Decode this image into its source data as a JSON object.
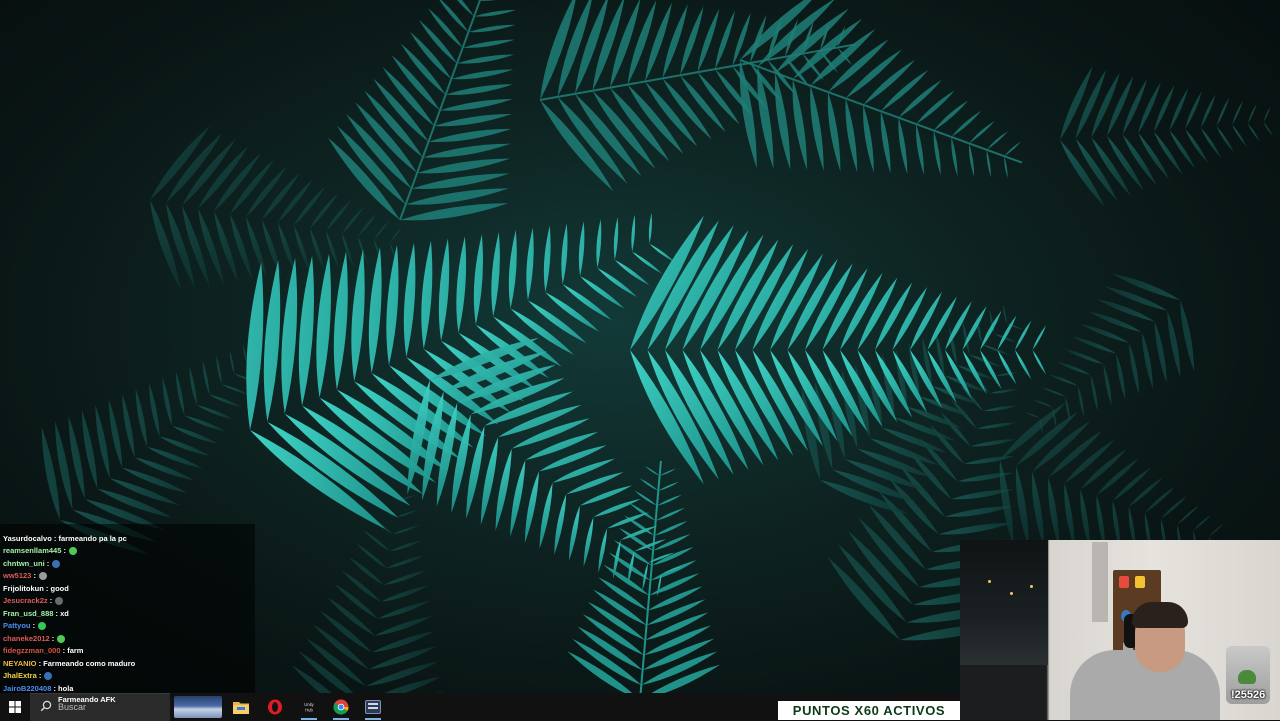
{
  "chat": {
    "messages": [
      {
        "user": "Yasurdocalvo",
        "user_color": "#ffffff",
        "text": "farmeando pa la pc",
        "emote": null
      },
      {
        "user": "reamsenllam445",
        "user_color": "#a5f0a8",
        "text": "",
        "emote": "#4ecb54"
      },
      {
        "user": "chntwn_uni",
        "user_color": "#a5f0a8",
        "text": "",
        "emote": "#3a6fb3"
      },
      {
        "user": "ww5123",
        "user_color": "#e05a5a",
        "text": "",
        "emote": "#9a9a9a"
      },
      {
        "user": "Frijolitokun",
        "user_color": "#ffffff",
        "text": "good",
        "emote": null
      },
      {
        "user": "Jesucrack2z",
        "user_color": "#e05a5a",
        "text": "",
        "emote": "#6b6b6b"
      },
      {
        "user": "Fran_usd_888",
        "user_color": "#a5f0a8",
        "text": "xd",
        "emote": null
      },
      {
        "user": "Pattyou",
        "user_color": "#4b8cf0",
        "text": "",
        "emote": "#34c759"
      },
      {
        "user": "chaneke2012",
        "user_color": "#e05a5a",
        "text": "",
        "emote": "#4ecb54"
      },
      {
        "user": "fidegzzman_000",
        "user_color": "#d9503b",
        "text": "farm",
        "emote": null
      },
      {
        "user": "NEYANIO",
        "user_color": "#f0b64b",
        "text": "Farmeando como maduro",
        "emote": null
      },
      {
        "user": "JhalExtra",
        "user_color": "#f0d24b",
        "text": "",
        "emote": "#3a6fb3"
      },
      {
        "user": "JairoB220408",
        "user_color": "#4b8cf0",
        "text": "hola",
        "emote": null
      }
    ],
    "last_message_text": "Farmeando AFK"
  },
  "taskbar": {
    "search_placeholder": "Buscar",
    "apps": [
      "files-icon",
      "opera-icon",
      "unknown-app-icon",
      "chrome-icon",
      "app-icon"
    ],
    "unknown_app_label": "Unity\nHub"
  },
  "overlay": {
    "points_banner": "PUNTOS X60 ACTIVOS",
    "cam_counter": "!25526"
  }
}
